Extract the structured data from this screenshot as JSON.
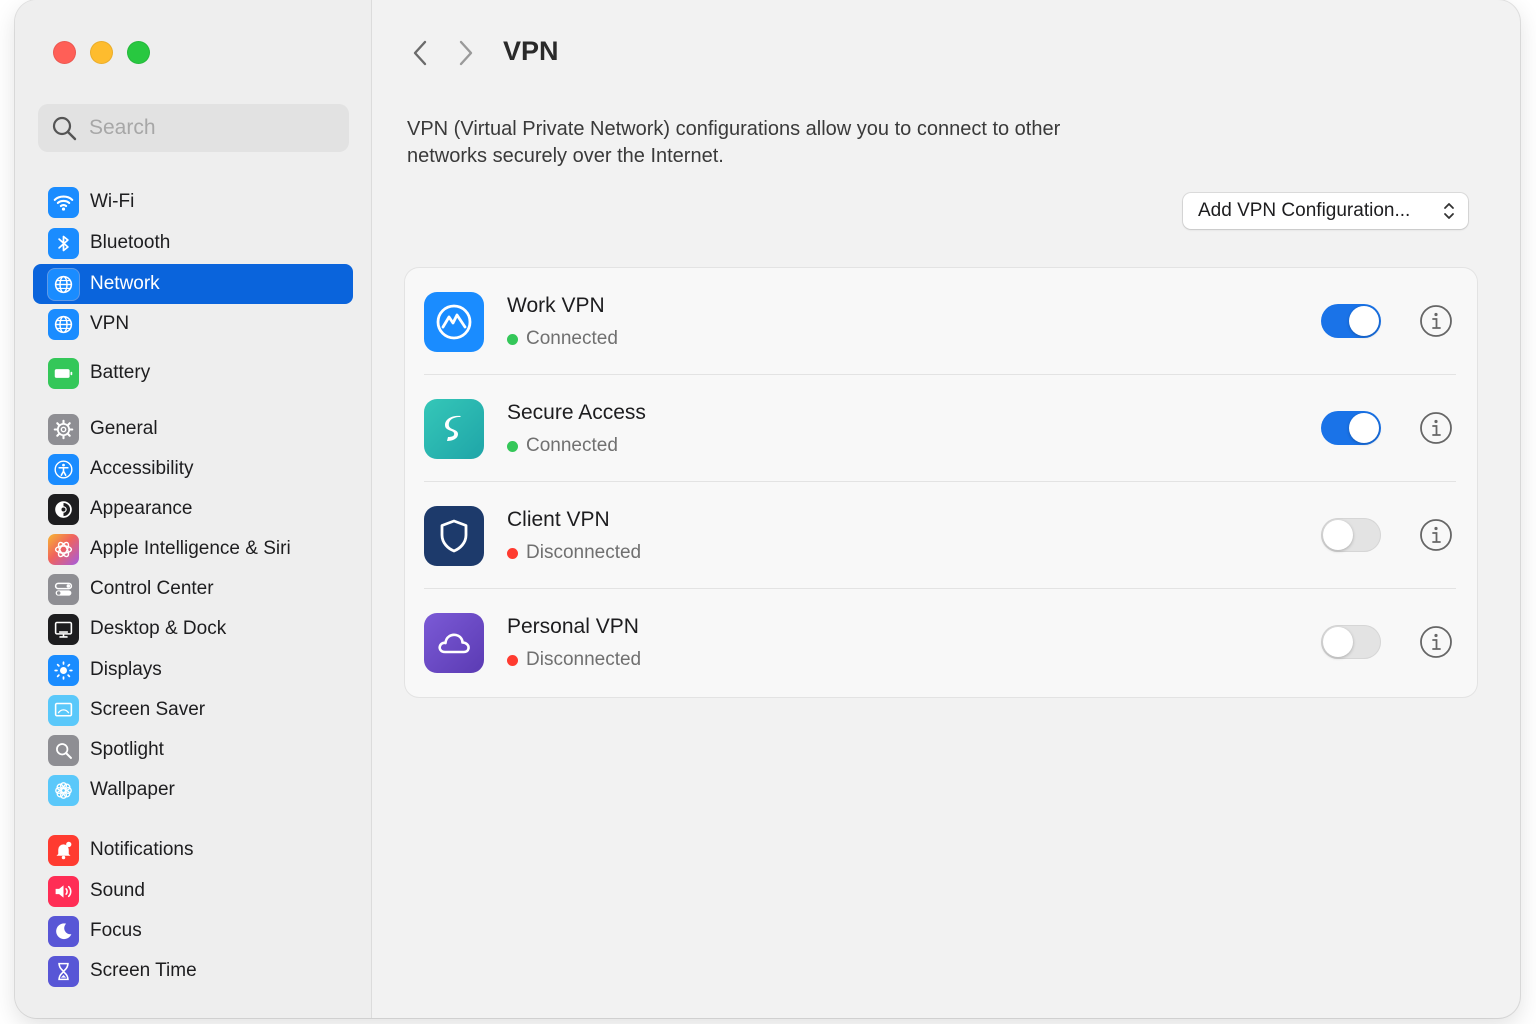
{
  "window": {
    "controls": [
      "close",
      "minimize",
      "zoom"
    ]
  },
  "sidebar": {
    "search_placeholder": "Search",
    "items": [
      {
        "label": "Wi-Fi",
        "icon": "wifi-icon",
        "color": "#1a8cff"
      },
      {
        "label": "Bluetooth",
        "icon": "bluetooth-icon",
        "color": "#1a8cff"
      },
      {
        "label": "Network",
        "icon": "globe-icon",
        "color": "#1a8cff",
        "selected": true
      },
      {
        "label": "VPN",
        "icon": "globe-icon",
        "color": "#1a8cff"
      },
      {
        "label": "Battery",
        "icon": "battery-icon",
        "color": "#34c759"
      },
      {
        "label": "General",
        "icon": "gear-icon",
        "color": "#8e8e93"
      },
      {
        "label": "Accessibility",
        "icon": "accessibility-icon",
        "color": "#1a8cff"
      },
      {
        "label": "Appearance",
        "icon": "appearance-icon",
        "color": "#1d1d1f"
      },
      {
        "label": "Apple Intelligence & Siri",
        "icon": "siri-icon",
        "color": "#f08a5d"
      },
      {
        "label": "Control Center",
        "icon": "control-center-icon",
        "color": "#8e8e93"
      },
      {
        "label": "Desktop & Dock",
        "icon": "desktop-icon",
        "color": "#1d1d1f"
      },
      {
        "label": "Displays",
        "icon": "sun-icon",
        "color": "#1a8cff"
      },
      {
        "label": "Screen Saver",
        "icon": "screen-saver-icon",
        "color": "#5ac8fa"
      },
      {
        "label": "Spotlight",
        "icon": "magnifier-icon",
        "color": "#8e8e93"
      },
      {
        "label": "Wallpaper",
        "icon": "flower-icon",
        "color": "#5ac8fa"
      },
      {
        "label": "Notifications",
        "icon": "bell-icon",
        "color": "#ff3b30"
      },
      {
        "label": "Sound",
        "icon": "speaker-icon",
        "color": "#ff2d55"
      },
      {
        "label": "Focus",
        "icon": "moon-icon",
        "color": "#5856d6"
      },
      {
        "label": "Screen Time",
        "icon": "hourglass-icon",
        "color": "#5856d6"
      }
    ]
  },
  "main": {
    "title": "VPN",
    "description": "VPN (Virtual Private Network) configurations allow you to connect to other networks securely over the Internet.",
    "add_button_label": "Add VPN Configuration...",
    "vpns": [
      {
        "name": "Work VPN",
        "status": "Connected",
        "status_color": "#34c759",
        "enabled": true,
        "icon": "mountain-icon",
        "icon_color": "#1a8cff"
      },
      {
        "name": "Secure Access",
        "status": "Connected",
        "status_color": "#34c759",
        "enabled": true,
        "icon": "surfshark-icon",
        "icon_color": "#2bb5b0"
      },
      {
        "name": "Client VPN",
        "status": "Disconnected",
        "status_color": "#ff3b30",
        "enabled": false,
        "icon": "shield-icon",
        "icon_color": "#1d3a6b"
      },
      {
        "name": "Personal VPN",
        "status": "Disconnected",
        "status_color": "#ff3b30",
        "enabled": false,
        "icon": "cloud-icon",
        "icon_color": "#6a4bc4"
      }
    ]
  },
  "colors": {
    "accent": "#0a64dc",
    "toggle_on": "#1a73e8",
    "connected": "#34c759",
    "disconnected": "#ff3b30"
  }
}
